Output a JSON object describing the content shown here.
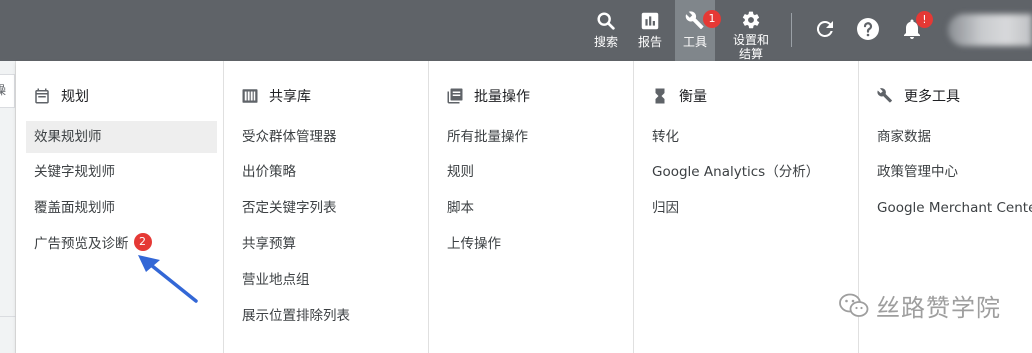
{
  "topbar": {
    "search": {
      "label": "搜索",
      "icon": "search-icon"
    },
    "reports": {
      "label": "报告",
      "icon": "bar-chart-icon"
    },
    "tools": {
      "label": "工具",
      "icon": "wrench-icon",
      "badge": "1"
    },
    "settings": {
      "label": "设置和结算",
      "icon": "gear-icon"
    },
    "refresh_icon": "refresh-icon",
    "help_icon": "help-icon",
    "notifications": {
      "icon": "bell-icon",
      "badge": "!"
    },
    "account": {
      "icon": "avatar"
    }
  },
  "left_partial_text": "操作",
  "columns": [
    {
      "title": "规划",
      "icon": "calendar-icon",
      "items": [
        "效果规划师",
        "关键字规划师",
        "覆盖面规划师",
        "广告预览及诊断"
      ]
    },
    {
      "title": "共享库",
      "icon": "library-icon",
      "items": [
        "受众群体管理器",
        "出价策略",
        "否定关键字列表",
        "共享预算",
        "营业地点组",
        "展示位置排除列表"
      ]
    },
    {
      "title": "批量操作",
      "icon": "copy-icon",
      "items": [
        "所有批量操作",
        "规则",
        "脚本",
        "上传操作"
      ]
    },
    {
      "title": "衡量",
      "icon": "hourglass-icon",
      "items": [
        "转化",
        "Google Analytics（分析）",
        "归因"
      ]
    },
    {
      "title": "更多工具",
      "icon": "wrench-icon",
      "items": [
        "商家数据",
        "政策管理中心",
        "Google Merchant Center"
      ]
    }
  ],
  "annotation": {
    "badge": "2",
    "arrow_icon": "arrow-icon",
    "color": "#3367d6"
  },
  "watermark": {
    "text": "丝路赞学院",
    "icon": "wechat-icon"
  },
  "colors": {
    "topbar": "#5f6368",
    "active_tab": "#80868b",
    "badge_red": "#e53935",
    "selected_row": "#eeeeee"
  }
}
